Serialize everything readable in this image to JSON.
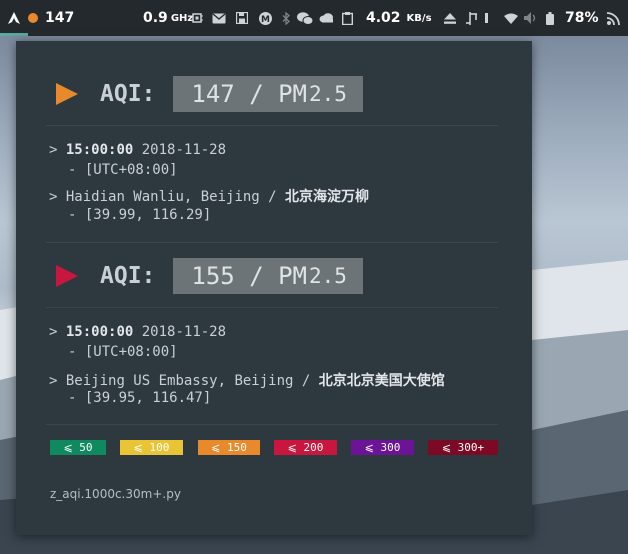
{
  "topbar": {
    "aqi_value": "147",
    "cpu_freq": "0.9",
    "cpu_unit": "GHz",
    "net_speed": "4.02",
    "net_unit": "KB/s",
    "battery": "78%",
    "icons": [
      "arch-logo-icon",
      "status-dot-icon",
      "chip-icon",
      "mail-icon",
      "save-icon",
      "mastodon-icon",
      "bluetooth-icon",
      "wechat-icon",
      "cloud-icon",
      "clipboard-icon",
      "eject-icon",
      "usb-icon",
      "wifi-icon",
      "volume-icon",
      "battery-icon",
      "rss-icon"
    ],
    "dot_color": "#e8892c"
  },
  "stations": [
    {
      "aqi_label": "AQI:",
      "aqi_text": "147 / PM",
      "pm_sub": "2.5",
      "arrow_color": "#e8892c",
      "time": "15:00:00",
      "date": "2018-11-28",
      "tz": "- [UTC+08:00]",
      "location_en": "Haidian Wanliu, Beijing /",
      "location_cn": "北京海淀万柳",
      "coords": "- [39.99, 116.29]"
    },
    {
      "aqi_label": "AQI:",
      "aqi_text": "155 / PM",
      "pm_sub": "2.5",
      "arrow_color": "#c8163e",
      "time": "15:00:00",
      "date": "2018-11-28",
      "tz": "- [UTC+08:00]",
      "location_en": "Beijing US Embassy, Beijing /",
      "location_cn": "北京北京美国大使馆",
      "coords": "- [39.95, 116.47]"
    }
  ],
  "prompt_char": ">",
  "legend": [
    {
      "label": "⩽ 50",
      "color": "#0e8a5e"
    },
    {
      "label": "⩽ 100",
      "color": "#e9c435"
    },
    {
      "label": "⩽ 150",
      "color": "#e8892c"
    },
    {
      "label": "⩽ 200",
      "color": "#c8163e"
    },
    {
      "label": "⩽ 300",
      "color": "#6b1596"
    },
    {
      "label": "⩽ 300+",
      "color": "#7d0a25"
    }
  ],
  "footer": "z_aqi.1000c.30m+.py"
}
